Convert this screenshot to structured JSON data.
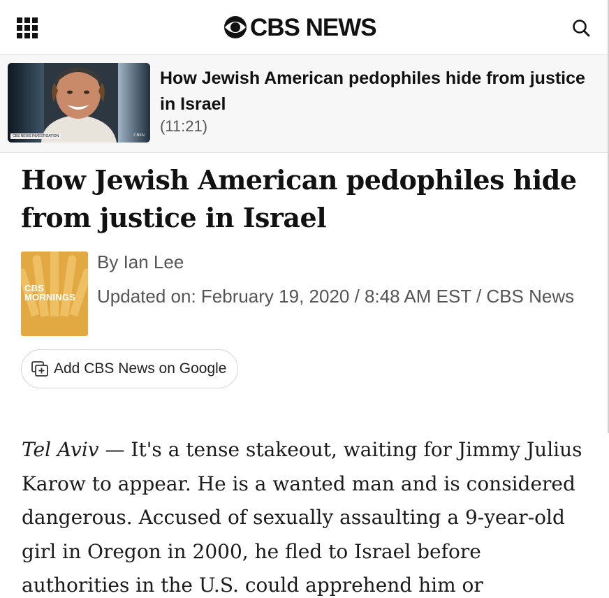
{
  "header": {
    "menu_icon": "grid-menu-icon",
    "logo_text": "CBS NEWS",
    "search_icon": "search-icon"
  },
  "now_playing": {
    "title": "How Jewish American pedophiles hide from justice in Israel",
    "duration": "(11:21)",
    "thumbnail_tag": "CBS NEWS INVESTIGATION",
    "thumbnail_logo": "CBSN"
  },
  "article": {
    "headline": "How Jewish American pedophiles hide from justice in Israel",
    "author": "By Ian Lee",
    "updated": "Updated on: February 19, 2020 / 8:48 AM EST / CBS News",
    "author_logo_line1": "CBS",
    "author_logo_line2": "MORNINGS",
    "google_button_label": "Add CBS News on Google",
    "dateline": "Tel Aviv",
    "body_text": " — It's a tense stakeout, waiting for Jimmy Julius Karow to appear. He is a wanted man and is considered dangerous. Accused of sexually assaulting a 9-year-old girl in Oregon in 2000, he fled to Israel before authorities in the U.S. could apprehend him or"
  },
  "colors": {
    "accent_gold": "#e2a842",
    "text_primary": "#111111",
    "text_secondary": "#555555"
  }
}
